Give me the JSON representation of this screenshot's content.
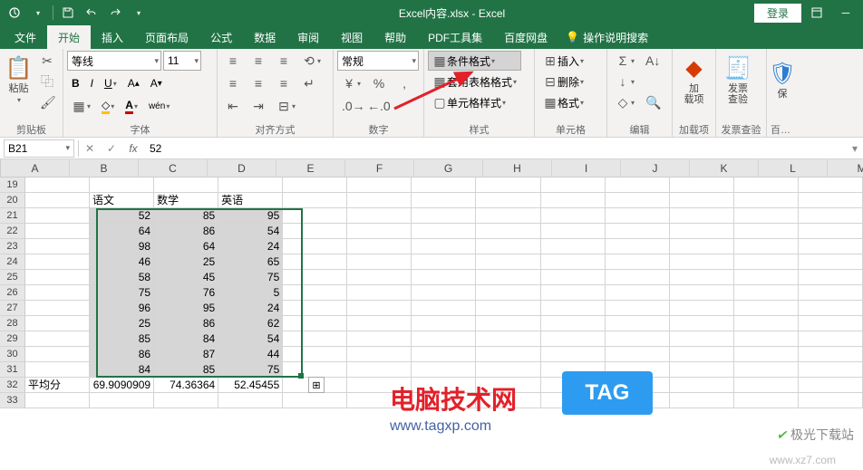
{
  "title": "Excel内容.xlsx - Excel",
  "login": "登录",
  "tabs": [
    "文件",
    "开始",
    "插入",
    "页面布局",
    "公式",
    "数据",
    "审阅",
    "视图",
    "帮助",
    "PDF工具集",
    "百度网盘"
  ],
  "active_tab": 1,
  "tellme": "操作说明搜索",
  "ribbon": {
    "clipboard": {
      "label": "剪贴板",
      "paste": "粘贴"
    },
    "font": {
      "label": "字体",
      "name": "等线",
      "size": "11"
    },
    "align": {
      "label": "对齐方式"
    },
    "number": {
      "label": "数字",
      "format": "常规"
    },
    "styles": {
      "label": "样式",
      "cond": "条件格式",
      "table": "套用表格格式",
      "cell": "单元格样式"
    },
    "cells": {
      "label": "单元格",
      "insert": "插入",
      "delete": "删除",
      "format": "格式"
    },
    "editing": {
      "label": "编辑"
    },
    "addins": {
      "label": "加载项",
      "addin": "加\n载项"
    },
    "invoice": {
      "label": "发票查验",
      "check": "发票\n查验"
    },
    "protect": {
      "label": "百…",
      "protect": "保"
    }
  },
  "namebox": "B21",
  "formula": "52",
  "columns": [
    "A",
    "B",
    "C",
    "D",
    "E",
    "F",
    "G",
    "H",
    "I",
    "J",
    "K",
    "L",
    "M"
  ],
  "rownums": [
    19,
    20,
    21,
    22,
    23,
    24,
    25,
    26,
    27,
    28,
    29,
    30,
    31,
    32,
    33
  ],
  "headers": {
    "b": "语文",
    "c": "数学",
    "d": "英语"
  },
  "data": [
    [
      52,
      85,
      95
    ],
    [
      64,
      86,
      54
    ],
    [
      98,
      64,
      24
    ],
    [
      46,
      25,
      65
    ],
    [
      58,
      45,
      75
    ],
    [
      75,
      76,
      5
    ],
    [
      96,
      95,
      24
    ],
    [
      25,
      86,
      62
    ],
    [
      85,
      84,
      54
    ],
    [
      86,
      87,
      44
    ],
    [
      84,
      85,
      75
    ]
  ],
  "avg_label": "平均分",
  "avgs": [
    "69.9090909",
    "74.36364",
    "52.45455"
  ],
  "watermark": {
    "txt1": "电脑技术网",
    "tag": "TAG",
    "url": "www.tagxp.com",
    "site": "极光下载站",
    "siteurl": "www.xz7.com"
  }
}
